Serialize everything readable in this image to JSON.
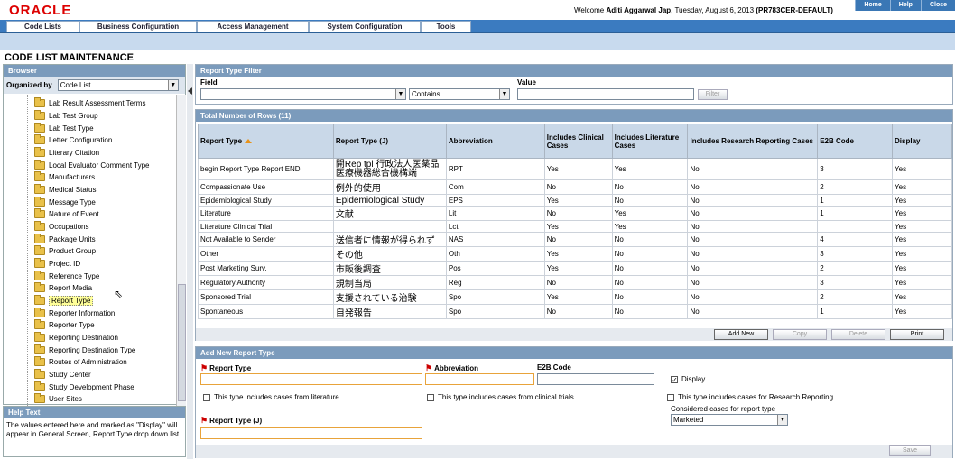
{
  "header": {
    "logo": "ORACLE",
    "welcome_prefix": "Welcome",
    "user": "Aditi Aggarwal Jap",
    "date": ", Tuesday, August 6, 2013",
    "instance": "(PR783CER-DEFAULT)",
    "links": [
      "Home",
      "Help",
      "Close"
    ]
  },
  "menu": [
    "Code Lists",
    "Business Configuration",
    "Access Management",
    "System Configuration",
    "Tools"
  ],
  "page_title": "CODE LIST MAINTENANCE",
  "browser": {
    "title": "Browser",
    "organized_by_label": "Organized by",
    "organized_by_value": "Code List",
    "items": [
      "Lab Result Assessment Terms",
      "Lab Test Group",
      "Lab Test Type",
      "Letter Configuration",
      "Literary Citation",
      "Local Evaluator Comment Type",
      "Manufacturers",
      "Medical Status",
      "Message Type",
      "Nature of Event",
      "Occupations",
      "Package Units",
      "Product Group",
      "Project ID",
      "Reference Type",
      "Report Media",
      "Report Type",
      "Reporter Information",
      "Reporter Type",
      "Reporting Destination",
      "Reporting Destination Type",
      "Routes of Administration",
      "Study Center",
      "Study Development Phase",
      "User Sites"
    ],
    "selected": "Report Type"
  },
  "help": {
    "title": "Help Text",
    "text": "The values entered here and marked as \"Display\" will appear in General Screen, Report Type drop down list."
  },
  "filter": {
    "title": "Report Type Filter",
    "field_label": "Field",
    "field_value": "",
    "operator_value": "Contains",
    "value_label": "Value",
    "value_value": "",
    "filter_button": "Filter"
  },
  "grid": {
    "title": "Total Number of Rows (11)",
    "columns": [
      "Report Type",
      "Report Type (J)",
      "Abbreviation",
      "Includes Clinical Cases",
      "Includes Literature Cases",
      "Includes Research Reporting Cases",
      "E2B Code",
      "Display"
    ],
    "rows": [
      [
        "begin  Report Type  Report END",
        "開Rep tpl 行政法人医薬品 医療機器総合機構端",
        "RPT",
        "Yes",
        "Yes",
        "No",
        "3",
        "Yes"
      ],
      [
        "Compassionate Use",
        "例外的使用",
        "Com",
        "No",
        "No",
        "No",
        "2",
        "Yes"
      ],
      [
        "Epidemiological Study",
        "Epidemiological Study",
        "EPS",
        "Yes",
        "No",
        "No",
        "1",
        "Yes"
      ],
      [
        "Literature",
        "文献",
        "Lit",
        "No",
        "Yes",
        "No",
        "1",
        "Yes"
      ],
      [
        "Literature Clinical Trial",
        "",
        "Lct",
        "Yes",
        "Yes",
        "No",
        "",
        "Yes"
      ],
      [
        "Not Available to Sender",
        "送信者に情報が得られず",
        "NAS",
        "No",
        "No",
        "No",
        "4",
        "Yes"
      ],
      [
        "Other",
        "その他",
        "Oth",
        "Yes",
        "No",
        "No",
        "3",
        "Yes"
      ],
      [
        "Post Marketing Surv.",
        "市販後調査",
        "Pos",
        "Yes",
        "No",
        "No",
        "2",
        "Yes"
      ],
      [
        "Regulatory Authority",
        "規制当局",
        "Reg",
        "No",
        "No",
        "No",
        "3",
        "Yes"
      ],
      [
        "Sponsored Trial",
        "支援されている治験",
        "Spo",
        "Yes",
        "No",
        "No",
        "2",
        "Yes"
      ],
      [
        "Spontaneous",
        "自発報告",
        "Spo",
        "No",
        "No",
        "No",
        "1",
        "Yes"
      ]
    ],
    "buttons": [
      "Add New",
      "Copy",
      "Delete",
      "Print"
    ]
  },
  "add_new": {
    "title": "Add New Report Type",
    "report_type_label": "Report Type",
    "abbreviation_label": "Abbreviation",
    "e2b_label": "E2B Code",
    "display_label": "Display",
    "display_checked": true,
    "literature_label": "This type includes cases from literature",
    "clinical_label": "This type includes cases from clinical trials",
    "research_label": "This type includes cases for Research Reporting",
    "considered_label": "Considered cases for report type",
    "considered_value": "Marketed",
    "report_type_j_label": "Report Type (J)",
    "save_button": "Save"
  }
}
